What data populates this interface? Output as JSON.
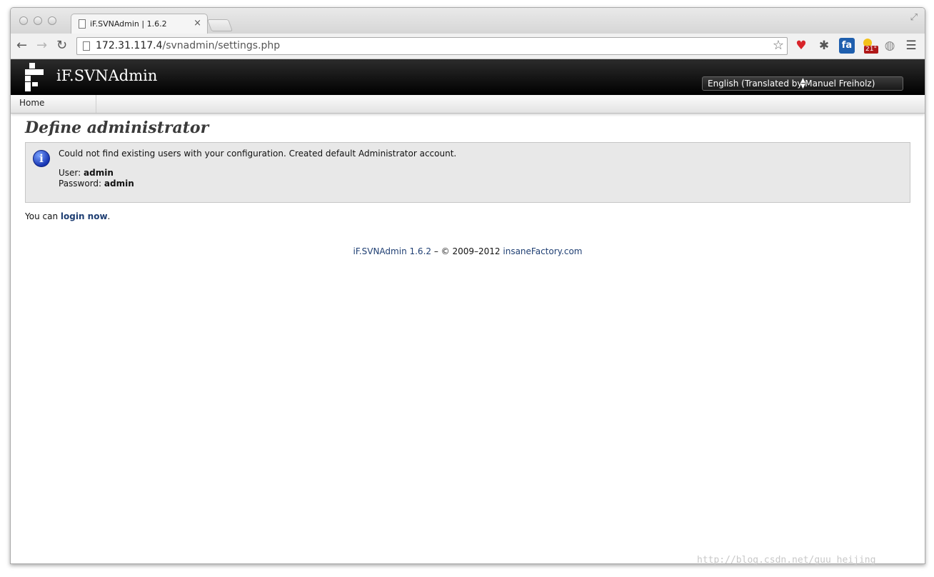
{
  "browser": {
    "tab_title": "iF.SVNAdmin | 1.6.2",
    "tab_close": "×",
    "url_host": "172.31.117.4",
    "url_path": "/svnadmin/settings.php",
    "icons": [
      "back-arrow-icon",
      "forward-arrow-icon",
      "reload-icon",
      "page-icon",
      "bookmark-star-icon",
      "heart-extension-icon",
      "bug-extension-icon",
      "fa-extension-icon",
      "weather-extension-icon",
      "globe-extension-icon",
      "menu-icon"
    ],
    "extension_badges": {
      "fa": "fa",
      "weather": "21°"
    }
  },
  "header": {
    "brand": "iF.SVNAdmin",
    "language": "English (Translated by Manuel Freiholz)"
  },
  "menu": {
    "home": "Home"
  },
  "main": {
    "title": "Define administrator",
    "info_message": "Could not find existing users with your configuration. Created default Administrator account.",
    "user_label": "User:",
    "user_value": "admin",
    "password_label": "Password:",
    "password_value": "admin",
    "login_prefix": "You can",
    "login_link": "login now",
    "login_suffix": "."
  },
  "footer": {
    "product": "iF.SVNAdmin 1.6.2",
    "copyright": " – © 2009–2012 ",
    "company": "insaneFactory.com"
  },
  "watermark": "http://blog.csdn.net/guu_heijing"
}
